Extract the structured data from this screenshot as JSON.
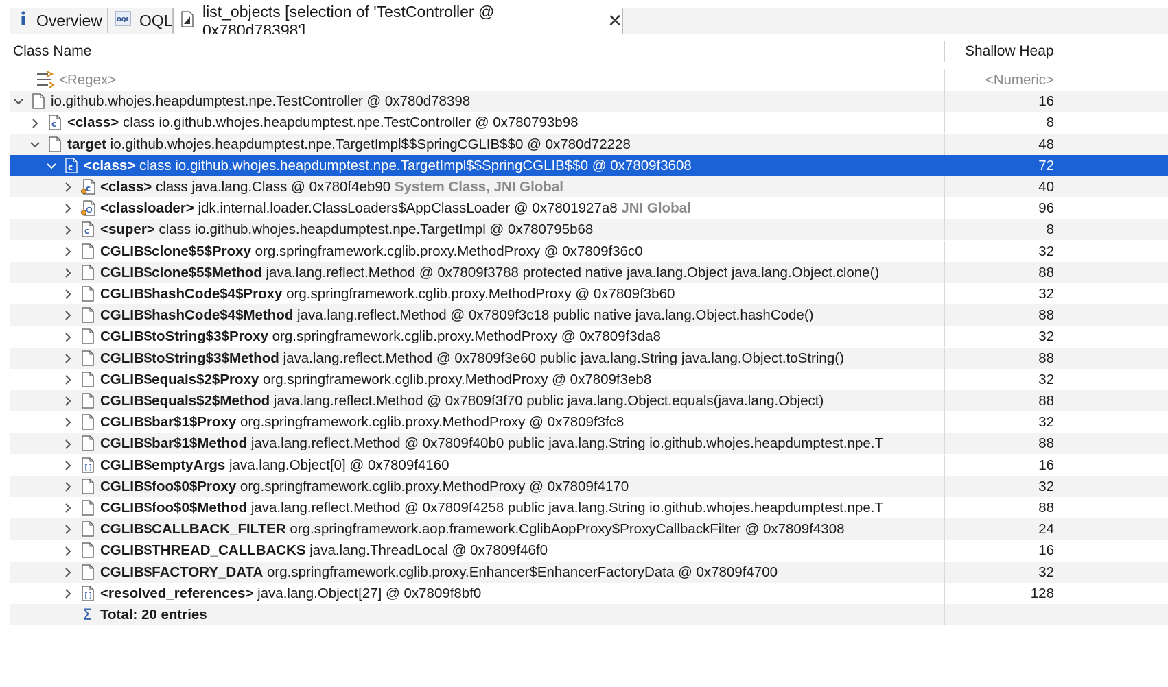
{
  "tabs": [
    {
      "label": "Overview",
      "icon": "info-icon"
    },
    {
      "label": "OQL",
      "icon": "oql-icon"
    },
    {
      "label": "list_objects [selection of 'TestController @ 0x780d78398']",
      "icon": "list-objects-icon",
      "active": true
    }
  ],
  "columns": {
    "class_name": "Class Name",
    "shallow_heap": "Shallow Heap"
  },
  "filter": {
    "regex": "<Regex>",
    "numeric": "<Numeric>"
  },
  "colors": {
    "selection": "#1a62d6",
    "muted": "#8a8a8a"
  },
  "rows": [
    {
      "depth": 0,
      "exp": "v",
      "icon": "object",
      "name": "",
      "text": "io.github.whojes.heapdumptest.npe.TestController @ 0x780d78398",
      "note": "",
      "heap": "16"
    },
    {
      "depth": 1,
      "exp": ">",
      "icon": "class",
      "name": "<class>",
      "text": "class io.github.whojes.heapdumptest.npe.TestController @ 0x780793b98",
      "note": "",
      "heap": "8"
    },
    {
      "depth": 1,
      "exp": "v",
      "icon": "object",
      "name": "target",
      "text": "io.github.whojes.heapdumptest.npe.TargetImpl$$SpringCGLIB$$0 @ 0x780d72228",
      "note": "",
      "heap": "48"
    },
    {
      "depth": 2,
      "exp": "v",
      "icon": "class",
      "name": "<class>",
      "text": "class io.github.whojes.heapdumptest.npe.TargetImpl$$SpringCGLIB$$0 @ 0x7809f3608",
      "note": "",
      "heap": "72",
      "selected": true
    },
    {
      "depth": 3,
      "exp": ">",
      "icon": "class-gc",
      "name": "<class>",
      "text": "class java.lang.Class @ 0x780f4eb90",
      "note": "System Class, JNI Global",
      "heap": "40"
    },
    {
      "depth": 3,
      "exp": ">",
      "icon": "loader-gc",
      "name": "<classloader>",
      "text": "jdk.internal.loader.ClassLoaders$AppClassLoader @ 0x7801927a8",
      "note": "JNI Global",
      "heap": "96"
    },
    {
      "depth": 3,
      "exp": ">",
      "icon": "class",
      "name": "<super>",
      "text": "class io.github.whojes.heapdumptest.npe.TargetImpl @ 0x780795b68",
      "note": "",
      "heap": "8"
    },
    {
      "depth": 3,
      "exp": ">",
      "icon": "object",
      "name": "CGLIB$clone$5$Proxy",
      "text": "org.springframework.cglib.proxy.MethodProxy @ 0x7809f36c0",
      "note": "",
      "heap": "32"
    },
    {
      "depth": 3,
      "exp": ">",
      "icon": "object",
      "name": "CGLIB$clone$5$Method",
      "text": "java.lang.reflect.Method @ 0x7809f3788  protected native java.lang.Object java.lang.Object.clone()",
      "note": "",
      "heap": "88"
    },
    {
      "depth": 3,
      "exp": ">",
      "icon": "object",
      "name": "CGLIB$hashCode$4$Proxy",
      "text": "org.springframework.cglib.proxy.MethodProxy @ 0x7809f3b60",
      "note": "",
      "heap": "32"
    },
    {
      "depth": 3,
      "exp": ">",
      "icon": "object",
      "name": "CGLIB$hashCode$4$Method",
      "text": "java.lang.reflect.Method @ 0x7809f3c18  public native  java.lang.Object.hashCode()",
      "note": "",
      "heap": "88"
    },
    {
      "depth": 3,
      "exp": ">",
      "icon": "object",
      "name": "CGLIB$toString$3$Proxy",
      "text": "org.springframework.cglib.proxy.MethodProxy @ 0x7809f3da8",
      "note": "",
      "heap": "32"
    },
    {
      "depth": 3,
      "exp": ">",
      "icon": "object",
      "name": "CGLIB$toString$3$Method",
      "text": "java.lang.reflect.Method @ 0x7809f3e60  public java.lang.String java.lang.Object.toString()",
      "note": "",
      "heap": "88"
    },
    {
      "depth": 3,
      "exp": ">",
      "icon": "object",
      "name": "CGLIB$equals$2$Proxy",
      "text": "org.springframework.cglib.proxy.MethodProxy @ 0x7809f3eb8",
      "note": "",
      "heap": "32"
    },
    {
      "depth": 3,
      "exp": ">",
      "icon": "object",
      "name": "CGLIB$equals$2$Method",
      "text": "java.lang.reflect.Method @ 0x7809f3f70  public  java.lang.Object.equals(java.lang.Object)",
      "note": "",
      "heap": "88"
    },
    {
      "depth": 3,
      "exp": ">",
      "icon": "object",
      "name": "CGLIB$bar$1$Proxy",
      "text": "org.springframework.cglib.proxy.MethodProxy @ 0x7809f3fc8",
      "note": "",
      "heap": "32"
    },
    {
      "depth": 3,
      "exp": ">",
      "icon": "object",
      "name": "CGLIB$bar$1$Method",
      "text": "java.lang.reflect.Method @ 0x7809f40b0  public java.lang.String io.github.whojes.heapdumptest.npe.T",
      "note": "",
      "heap": "88"
    },
    {
      "depth": 3,
      "exp": ">",
      "icon": "array",
      "name": "CGLIB$emptyArgs",
      "text": "java.lang.Object[0] @ 0x7809f4160",
      "note": "",
      "heap": "16"
    },
    {
      "depth": 3,
      "exp": ">",
      "icon": "object",
      "name": "CGLIB$foo$0$Proxy",
      "text": "org.springframework.cglib.proxy.MethodProxy @ 0x7809f4170",
      "note": "",
      "heap": "32"
    },
    {
      "depth": 3,
      "exp": ">",
      "icon": "object",
      "name": "CGLIB$foo$0$Method",
      "text": "java.lang.reflect.Method @ 0x7809f4258  public java.lang.String io.github.whojes.heapdumptest.npe.T",
      "note": "",
      "heap": "88"
    },
    {
      "depth": 3,
      "exp": ">",
      "icon": "object",
      "name": "CGLIB$CALLBACK_FILTER",
      "text": "org.springframework.aop.framework.CglibAopProxy$ProxyCallbackFilter @ 0x7809f4308",
      "note": "",
      "heap": "24"
    },
    {
      "depth": 3,
      "exp": ">",
      "icon": "object",
      "name": "CGLIB$THREAD_CALLBACKS",
      "text": "java.lang.ThreadLocal @ 0x7809f46f0",
      "note": "",
      "heap": "16"
    },
    {
      "depth": 3,
      "exp": ">",
      "icon": "object",
      "name": "CGLIB$FACTORY_DATA",
      "text": "org.springframework.cglib.proxy.Enhancer$EnhancerFactoryData @ 0x7809f4700",
      "note": "",
      "heap": "32"
    },
    {
      "depth": 3,
      "exp": ">",
      "icon": "array",
      "name": "<resolved_references>",
      "text": "java.lang.Object[27] @ 0x7809f8bf0",
      "note": "",
      "heap": "128"
    },
    {
      "depth": 3,
      "exp": "",
      "icon": "sum",
      "name": "Total: 20 entries",
      "text": "",
      "note": "",
      "heap": ""
    }
  ]
}
